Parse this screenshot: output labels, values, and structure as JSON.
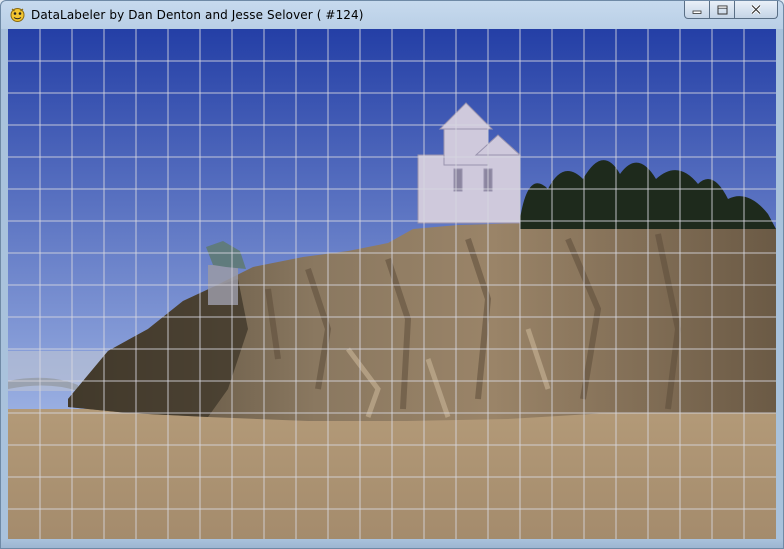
{
  "window": {
    "title": "DataLabeler by Dan Denton and Jesse Selover ( #124)",
    "app_icon": "pygame-snake-icon",
    "controls": [
      "minimize-icon",
      "maximize-icon",
      "close-icon"
    ]
  },
  "canvas": {
    "scene": "landscape-photo",
    "grid": {
      "columns": 24,
      "rows": 16,
      "line_color": "#d8d8e0"
    },
    "colors": {
      "sky_top": "#243fa6",
      "sky_bottom": "#9fb4e4",
      "river": "#a48b6c",
      "cliff": "#7a6a55",
      "church": "#c8c4d8"
    }
  }
}
